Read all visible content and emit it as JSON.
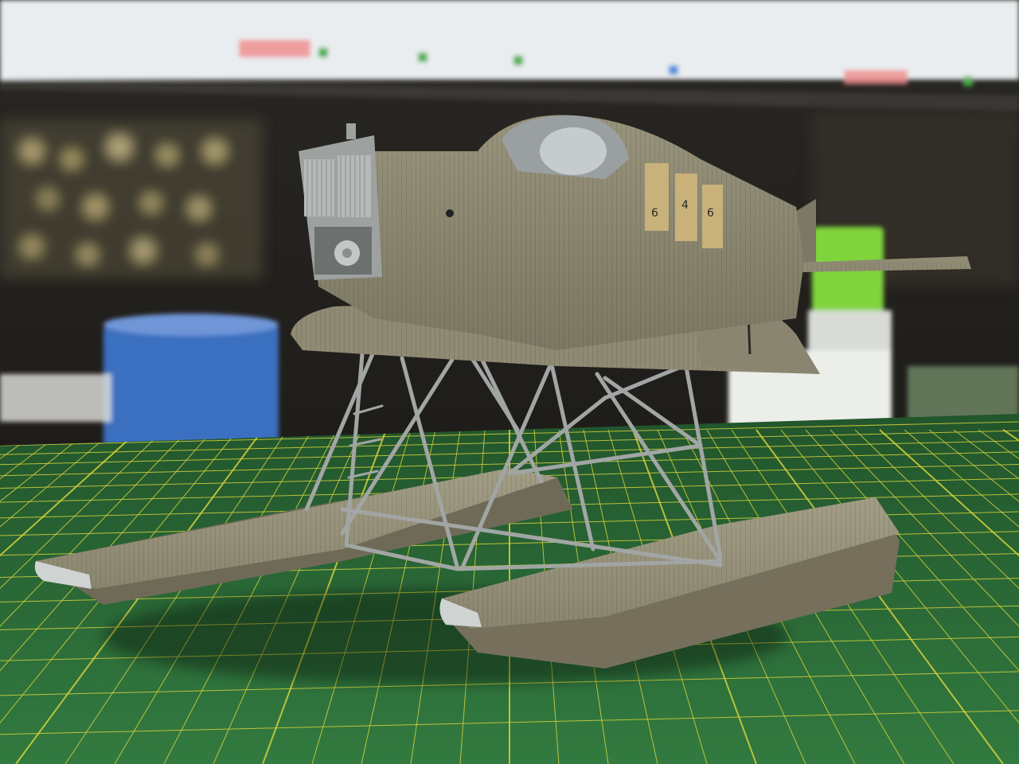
{
  "scene": {
    "subject": "seaplane-scale-model",
    "colors": {
      "plastic": "#8f8a73",
      "plastic_dark": "#6f6b58",
      "plastic_light": "#a39e86",
      "grey_parts": "#9ea3a3",
      "strut": "#9aa09e",
      "window_panel": "#c8b27a",
      "mat_green": "#2f6e3a",
      "mat_grid": "#d7d23a",
      "tape_blue": "#3a6fc0",
      "monitor": "#e8ecef"
    },
    "panel_numbers": [
      "6",
      "4",
      "6"
    ]
  }
}
